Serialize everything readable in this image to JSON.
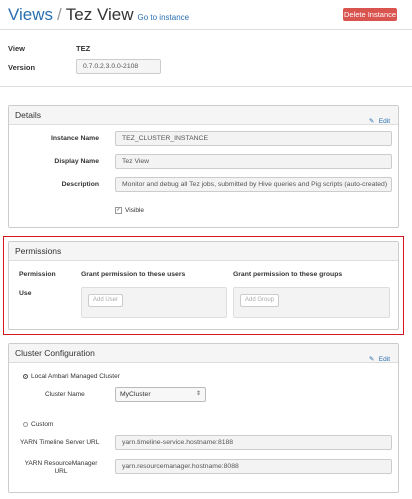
{
  "header": {
    "views_link": "Views",
    "separator": "/",
    "current_view": "Tez View",
    "goto_link": "Go to instance",
    "delete_button": "Delete Instance"
  },
  "summary": {
    "view_label": "View",
    "view_value": "TEZ",
    "version_label": "Version",
    "version_value": "0.7.0.2.3.0.0-2108"
  },
  "details": {
    "title": "Details",
    "edit_label": "Edit",
    "instance_name_label": "Instance Name",
    "instance_name_value": "TEZ_CLUSTER_INSTANCE",
    "display_name_label": "Display Name",
    "display_name_value": "Tez View",
    "description_label": "Description",
    "description_value": "Monitor and debug all Tez jobs, submitted by Hive queries and Pig scripts (auto-created)",
    "visible_label": "Visible",
    "visible_checked": true
  },
  "permissions": {
    "title": "Permissions",
    "col_permission": "Permission",
    "col_users": "Grant permission to these users",
    "col_groups": "Grant permission to these groups",
    "row_use": "Use",
    "add_user_placeholder": "Add User",
    "add_group_placeholder": "Add Group"
  },
  "cluster": {
    "title": "Cluster Configuration",
    "edit_label": "Edit",
    "local_option": "Local Ambari Managed Cluster",
    "cluster_name_label": "Cluster Name",
    "cluster_name_value": "MyCluster",
    "custom_option": "Custom",
    "yarn_timeline_label": "YARN Timeline Server URL",
    "yarn_timeline_value": "yarn.timeline-service.hostname:8188",
    "yarn_rm_label_line1": "YARN ResourceManager",
    "yarn_rm_label_line2": "URL",
    "yarn_rm_value": "yarn.resourcemanager.hostname:8088"
  },
  "colors": {
    "link": "#2a6fb0",
    "danger": "#d9534f",
    "highlight_frame": "#d9161c"
  }
}
